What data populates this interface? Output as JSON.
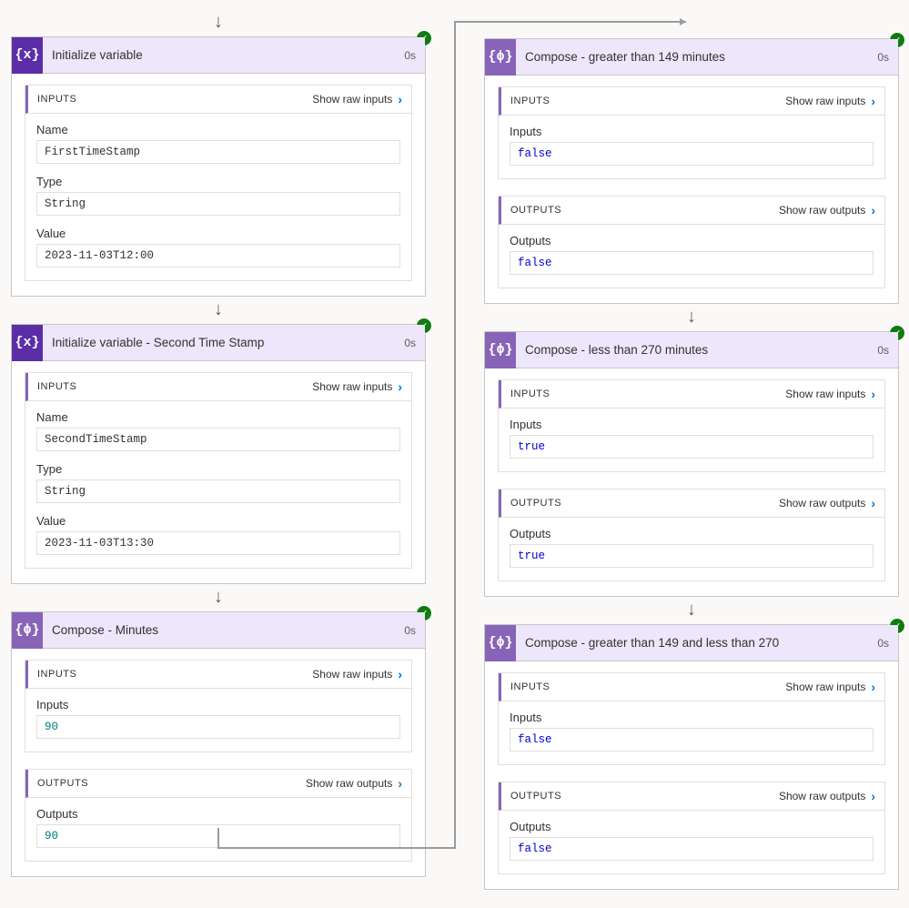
{
  "common": {
    "duration": "0s",
    "inputs_label": "INPUTS",
    "outputs_label": "OUTPUTS",
    "show_raw_inputs": "Show raw inputs",
    "show_raw_outputs": "Show raw outputs",
    "name_label": "Name",
    "type_label": "Type",
    "value_label": "Value",
    "inputs_field": "Inputs",
    "outputs_field": "Outputs"
  },
  "left": {
    "card1": {
      "icon_text": "{x}",
      "title": "Initialize variable",
      "name": "FirstTimeStamp",
      "type": "String",
      "value": "2023-11-03T12:00"
    },
    "card2": {
      "icon_text": "{x}",
      "title": "Initialize variable - Second Time Stamp",
      "name": "SecondTimeStamp",
      "type": "String",
      "value": "2023-11-03T13:30"
    },
    "card3": {
      "icon_text": "{ϕ}",
      "title": "Compose - Minutes",
      "inputs": "90",
      "outputs": "90"
    }
  },
  "right": {
    "card1": {
      "icon_text": "{ϕ}",
      "title": "Compose - greater than 149 minutes",
      "inputs": "false",
      "outputs": "false"
    },
    "card2": {
      "icon_text": "{ϕ}",
      "title": "Compose - less than 270 minutes",
      "inputs": "true",
      "outputs": "true"
    },
    "card3": {
      "icon_text": "{ϕ}",
      "title": "Compose - greater than 149 and less than 270",
      "inputs": "false",
      "outputs": "false"
    }
  }
}
